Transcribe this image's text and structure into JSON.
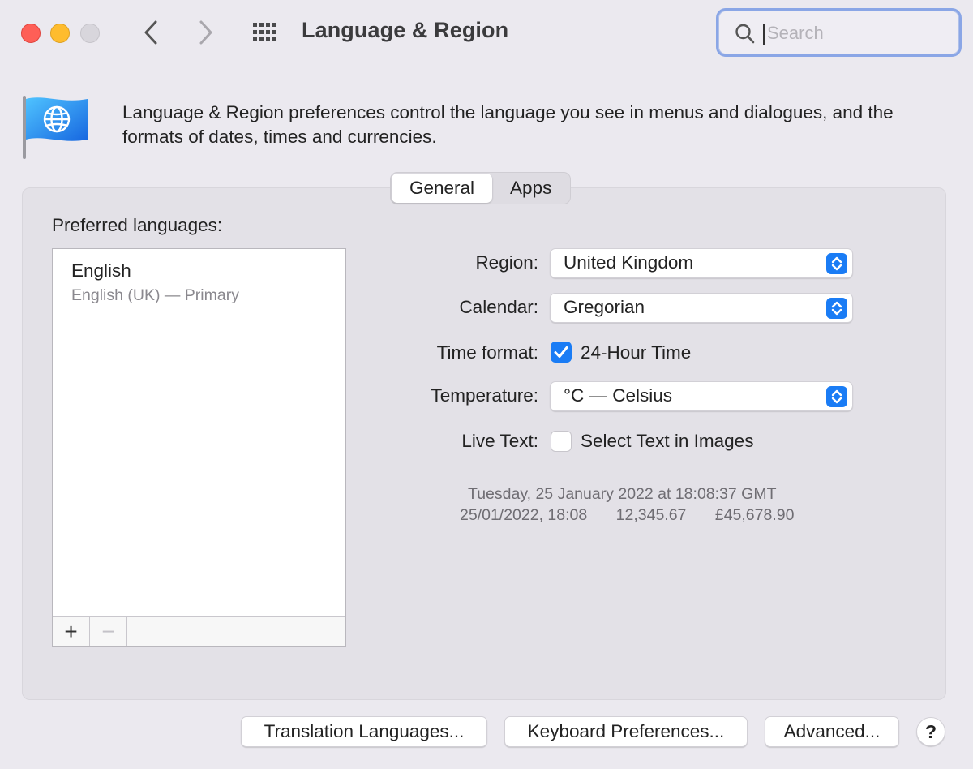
{
  "window": {
    "title": "Language & Region",
    "search_placeholder": "Search"
  },
  "header": {
    "description": "Language & Region preferences control the language you see in menus and dialogues, and the formats of dates, times and currencies.",
    "icon": "globe-flag-icon"
  },
  "tabs": [
    {
      "label": "General",
      "active": true
    },
    {
      "label": "Apps",
      "active": false
    }
  ],
  "languages": {
    "label": "Preferred languages:",
    "items": [
      {
        "name": "English",
        "detail": "English (UK) — Primary"
      }
    ],
    "add_symbol": "+",
    "remove_symbol": "−"
  },
  "settings": {
    "region": {
      "label": "Region:",
      "value": "United Kingdom"
    },
    "calendar": {
      "label": "Calendar:",
      "value": "Gregorian"
    },
    "time_format": {
      "label": "Time format:",
      "option": "24-Hour Time",
      "checked": true
    },
    "temperature": {
      "label": "Temperature:",
      "value": "°C — Celsius"
    },
    "live_text": {
      "label": "Live Text:",
      "option": "Select Text in Images",
      "checked": false
    }
  },
  "sample": {
    "line1": "Tuesday, 25 January 2022 at 18:08:37 GMT",
    "date_time": "25/01/2022, 18:08",
    "number": "12,345.67",
    "currency": "£45,678.90"
  },
  "buttons": {
    "translation": "Translation Languages...",
    "keyboard": "Keyboard Preferences...",
    "advanced": "Advanced...",
    "help": "?"
  },
  "colors": {
    "accent": "#1a7cf5",
    "close": "#fe5f57",
    "minimize": "#febc2e"
  }
}
